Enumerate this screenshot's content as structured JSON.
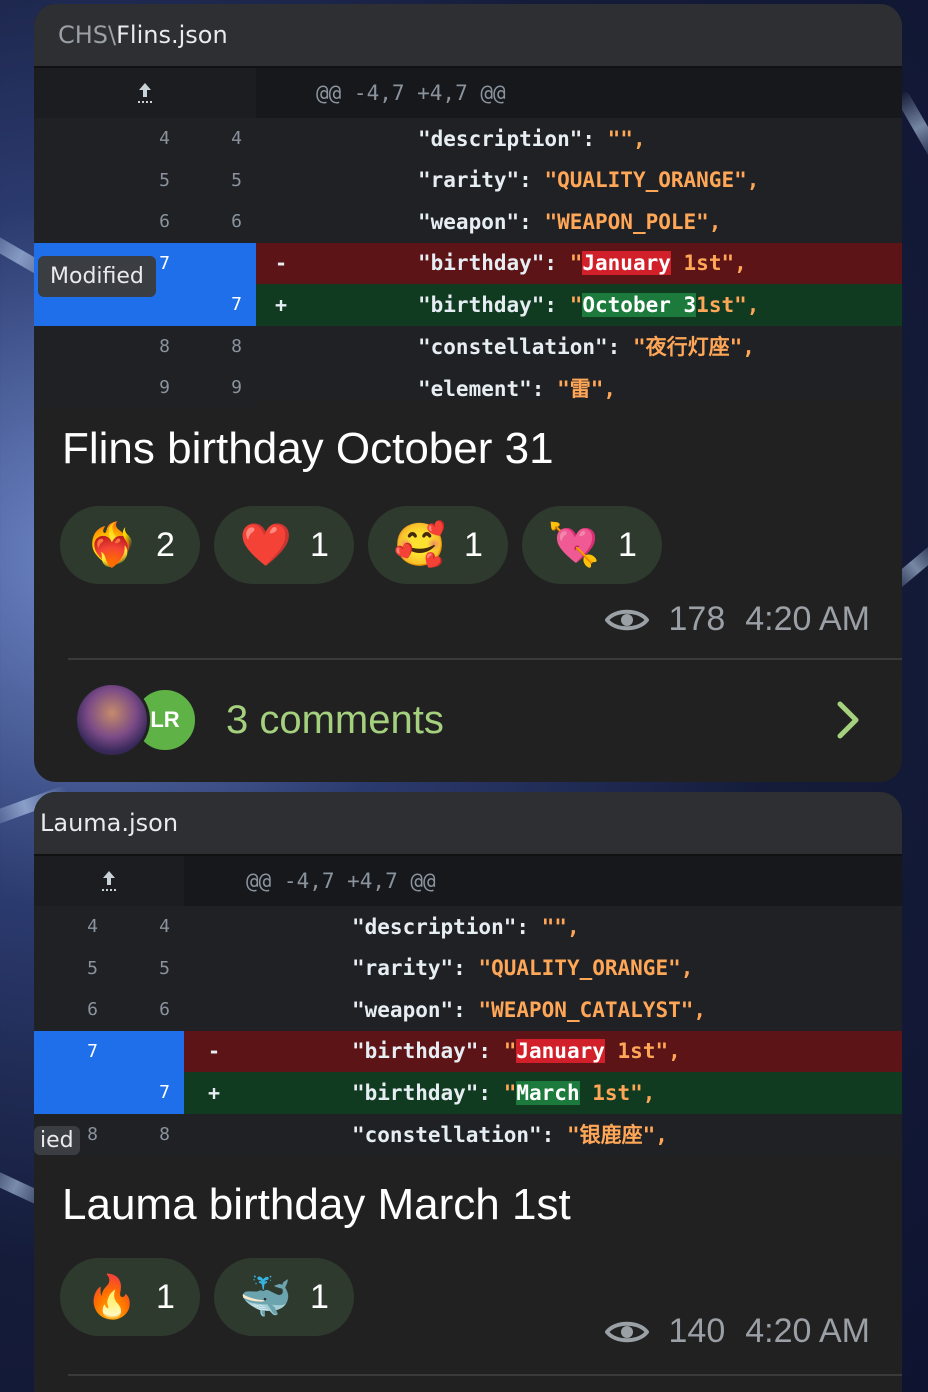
{
  "posts": [
    {
      "file": {
        "dir": "CHS\\",
        "name": "Flins.json"
      },
      "hunk": "@@ -4,7 +4,7 @@",
      "hunk_icon": "expand-up-icon",
      "lines": [
        {
          "old": "4",
          "new": "4",
          "sign": "",
          "key": "\"description\": ",
          "val_pre": "\"\",",
          "hl": "",
          "val_post": "",
          "type": "ctx"
        },
        {
          "old": "5",
          "new": "5",
          "sign": "",
          "key": "\"rarity\": ",
          "val_pre": "\"QUALITY_ORANGE\",",
          "hl": "",
          "val_post": "",
          "type": "ctx"
        },
        {
          "old": "6",
          "new": "6",
          "sign": "",
          "key": "\"weapon\": ",
          "val_pre": "\"WEAPON_POLE\",",
          "hl": "",
          "val_post": "",
          "type": "ctx"
        },
        {
          "old": "7",
          "new": "",
          "sign": "-",
          "key": "\"birthday\": ",
          "val_pre": "\"",
          "hl": "January",
          "val_post": " 1st\",",
          "type": "del"
        },
        {
          "old": "",
          "new": "7",
          "sign": "+",
          "key": "\"birthday\": ",
          "val_pre": "\"",
          "hl": "October 3",
          "val_post": "1st\",",
          "type": "add"
        },
        {
          "old": "8",
          "new": "8",
          "sign": "",
          "key": "\"constellation\": ",
          "val_pre": "\"夜行灯座\",",
          "hl": "",
          "val_post": "",
          "type": "ctx"
        },
        {
          "old": "9",
          "new": "9",
          "sign": "",
          "key": "\"element\": ",
          "val_pre": "\"雷\",",
          "hl": "",
          "val_post": "",
          "type": "ctx"
        }
      ],
      "tooltip": "Modified",
      "title": "Flins birthday October 31",
      "reactions": [
        {
          "emoji": "❤️‍🔥",
          "icon": "heart-on-fire-icon",
          "count": "2"
        },
        {
          "emoji": "❤️",
          "icon": "red-heart-icon",
          "count": "1"
        },
        {
          "emoji": "🥰",
          "icon": "smiling-face-hearts-icon",
          "count": "1"
        },
        {
          "emoji": "💘",
          "icon": "heart-with-arrow-icon",
          "count": "1"
        }
      ],
      "views": "178",
      "time": "4:20 AM",
      "comments": {
        "avatar2_initials": "LR",
        "label": "3 comments"
      }
    },
    {
      "file": {
        "dir": "",
        "name": "Lauma.json"
      },
      "hunk": "@@ -4,7 +4,7 @@",
      "hunk_icon": "expand-up-icon",
      "lines": [
        {
          "old": "4",
          "new": "4",
          "sign": "",
          "key": "\"description\": ",
          "val_pre": "\"\",",
          "hl": "",
          "val_post": "",
          "type": "ctx"
        },
        {
          "old": "5",
          "new": "5",
          "sign": "",
          "key": "\"rarity\": ",
          "val_pre": "\"QUALITY_ORANGE\",",
          "hl": "",
          "val_post": "",
          "type": "ctx"
        },
        {
          "old": "6",
          "new": "6",
          "sign": "",
          "key": "\"weapon\": ",
          "val_pre": "\"WEAPON_CATALYST\",",
          "hl": "",
          "val_post": "",
          "type": "ctx"
        },
        {
          "old": "7",
          "new": "",
          "sign": "-",
          "key": "\"birthday\": ",
          "val_pre": "\"",
          "hl": "January",
          "val_post": " 1st\",",
          "type": "del"
        },
        {
          "old": "",
          "new": "7",
          "sign": "+",
          "key": "\"birthday\": ",
          "val_pre": "\"",
          "hl": "March",
          "val_post": " 1st\",",
          "type": "add"
        },
        {
          "old": "8",
          "new": "8",
          "sign": "",
          "key": "\"constellation\": ",
          "val_pre": "\"银鹿座\",",
          "hl": "",
          "val_post": "",
          "type": "ctx"
        }
      ],
      "tooltip": "ied",
      "title": "Lauma birthday March 1st",
      "reactions": [
        {
          "emoji": "🔥",
          "icon": "fire-icon",
          "count": "1"
        },
        {
          "emoji": "🐳",
          "icon": "spouting-whale-icon",
          "count": "1"
        }
      ],
      "views": "140",
      "time": "4:20 AM"
    }
  ]
}
